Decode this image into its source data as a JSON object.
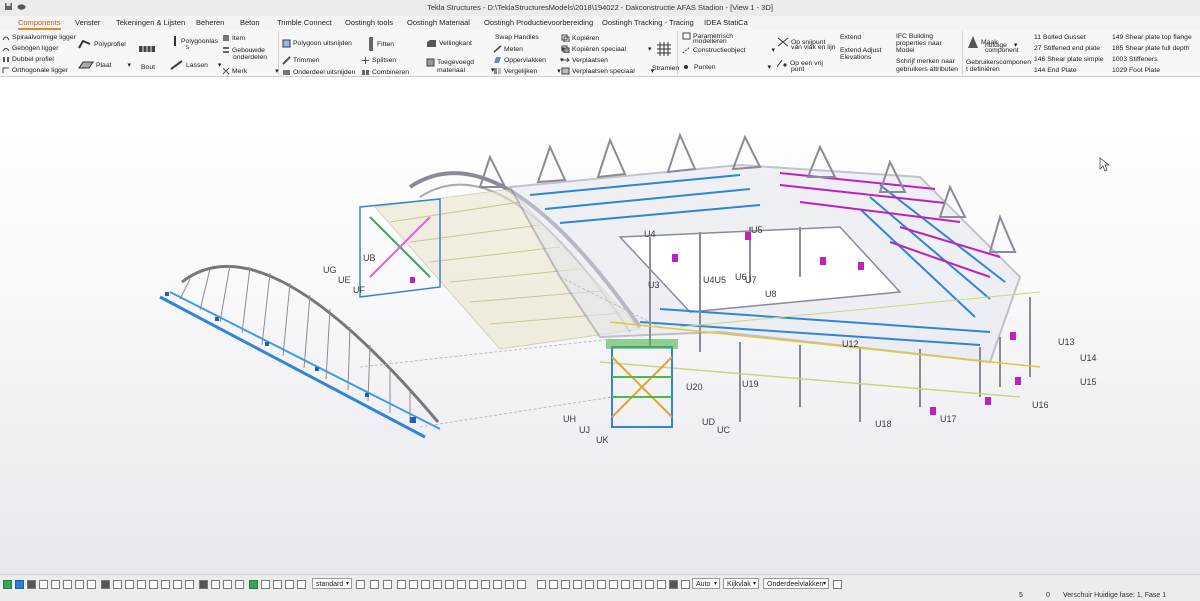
{
  "window": {
    "title": "Tekla Structures - D:\\TeklaStructuresModels\\2018\\194022 - Dakconstructie AFAS Stadion - [View 1 - 3D]"
  },
  "colors": {
    "accent": "#e08a2c",
    "steel_grey": "#8a8a99",
    "member_blue": "#2f86d6",
    "magenta": "#c020c0",
    "green": "#4cb848",
    "yellow": "#e2c640"
  },
  "tabs": [
    {
      "label": "Components",
      "active": true
    },
    {
      "label": "Venster"
    },
    {
      "label": "Tekeningen & Lijsten"
    },
    {
      "label": "Beheren"
    },
    {
      "label": "Beton"
    },
    {
      "label": "Trimble Connect"
    },
    {
      "label": "Oostingh tools"
    },
    {
      "label": "Oostingh Materiaal"
    },
    {
      "label": "Oostingh Productievoorbereiding"
    },
    {
      "label": "Oostingh Tracking - Tracing"
    },
    {
      "label": "IDEA StatiCa"
    }
  ],
  "ribbon": {
    "spiraal": "Spiraalvormige ligger",
    "gebogen": "Gebogen ligger",
    "dubbel": "Dubbel profiel",
    "orthogonaal": "Orthogonale ligger",
    "polyprofiel": "Polyprofiel",
    "plaat": "Plaat",
    "bout": "Bout",
    "polygoonlas": "Polygoonlas",
    "polygoonlas2": "s",
    "lassen": "Lassen",
    "item": "Item",
    "gebouwde": "Gebouwde",
    "onderdelen": "onderdelen",
    "merk": "Merk",
    "polygoon_uitsnijden": "Polygoon uitsnijden",
    "trimmen": "Trimmen",
    "onderdeel_uitsnijden": "Onderdeel uitsnijden",
    "fitten": "Fitten",
    "splitsen": "Splitsen",
    "combineren": "Combineren",
    "vellingkant": "Vellingkant",
    "toegevoegd": "Toegevoegd",
    "materiaal": "materiaal",
    "swap_handles": "Swap Handles",
    "meten": "Meten",
    "oppervlakken": "Oppervlakken",
    "vergelijken": "Vergelijken",
    "kopieren": "Kopiëren",
    "kopieren_speciaal": "Kopiëren speciaal",
    "verplaatsen": "Verplaatsen",
    "verplaatsen_speciaal": "Verplaatsen speciaal",
    "stramien": "Stramien",
    "parametrisch": "Parametrisch",
    "modelleren": "modelleren",
    "constructieobject": "Constructieobject",
    "punten": "Punten",
    "op_snijpunt": "Op snijpunt",
    "van_vlak": "van vlak en lijn",
    "op_een_vrij": "Op een vrij",
    "punt": "punt",
    "extend": "Extend",
    "extend_adjust": "Extend Adjust",
    "elevations": "Elevations",
    "ifc1": "IFC Building",
    "ifc2": "properties naar",
    "ifc3": "Model",
    "schrijf1": "Schrijf merken naar",
    "schrijf2": "gebruikers attributen",
    "maak1": "Maak",
    "maak2": "huidige",
    "maak3": "component",
    "gebr1": "Gebruikerscomponen",
    "gebr2": "t definiëren",
    "c11": "11 Bolted Gusset",
    "c27": "27 Stiffened end plate",
    "c146": "146 Shear plate simple",
    "c144": "144 End Plate",
    "c149": "149 Shear plate top flange",
    "c185": "185 Shear plate full depth",
    "c1003": "1003 Stiffeners",
    "c1029": "1029 Foot Plate"
  },
  "grid_labels": [
    {
      "label": "U4"
    },
    {
      "label": "U5"
    },
    {
      "label": "U4U5"
    },
    {
      "label": "U6"
    },
    {
      "label": "U7"
    },
    {
      "label": "U3"
    },
    {
      "label": "U8"
    },
    {
      "label": "UG"
    },
    {
      "label": "UE"
    },
    {
      "label": "UF"
    },
    {
      "label": "UB"
    },
    {
      "label": "U12"
    },
    {
      "label": "U13"
    },
    {
      "label": "U14"
    },
    {
      "label": "U15"
    },
    {
      "label": "U16"
    },
    {
      "label": "U17"
    },
    {
      "label": "U18"
    },
    {
      "label": "U19"
    },
    {
      "label": "U20"
    },
    {
      "label": "UH"
    },
    {
      "label": "UJ"
    },
    {
      "label": "UK"
    },
    {
      "label": "UC"
    },
    {
      "label": "UD"
    }
  ],
  "bottom": {
    "standard": "standard",
    "auto": "Auto",
    "kijkvlak": "Kijkvlak",
    "onderdeelvlakken": "Onderdeelvlakken",
    "count1": "5",
    "count2": "0",
    "status": "Verschuir Huidige fase: 1, Fase 1"
  }
}
